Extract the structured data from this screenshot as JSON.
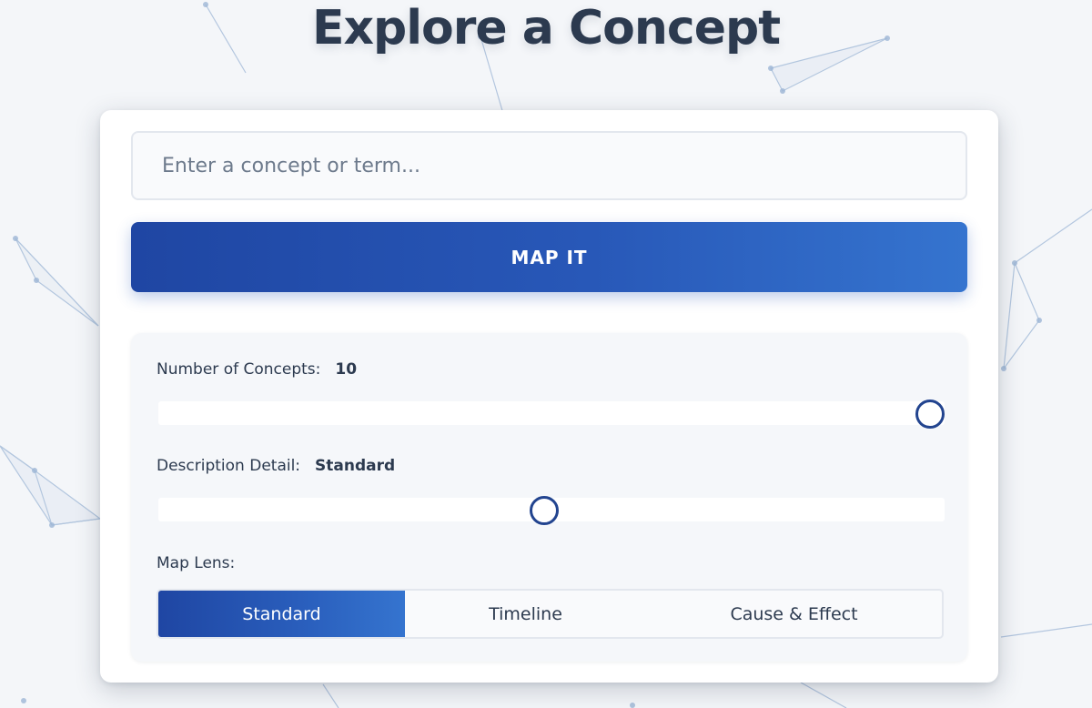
{
  "header": {
    "title": "Explore a Concept"
  },
  "search": {
    "placeholder": "Enter a concept or term...",
    "value": ""
  },
  "map_button": {
    "label": "MAP IT"
  },
  "options": {
    "concepts": {
      "label": "Number of Concepts:",
      "value": "10",
      "level": 1.0
    },
    "detail": {
      "label": "Description Detail:",
      "value": "Standard",
      "level": 0.5
    },
    "lens": {
      "label": "Map Lens:",
      "buttons": [
        {
          "label": "Standard",
          "active": true
        },
        {
          "label": "Timeline",
          "active": false
        },
        {
          "label": "Cause & Effect",
          "active": false
        }
      ]
    }
  },
  "colors": {
    "accent": "#2858b8",
    "title": "#2c3a4f",
    "background": "#f4f6f9"
  }
}
